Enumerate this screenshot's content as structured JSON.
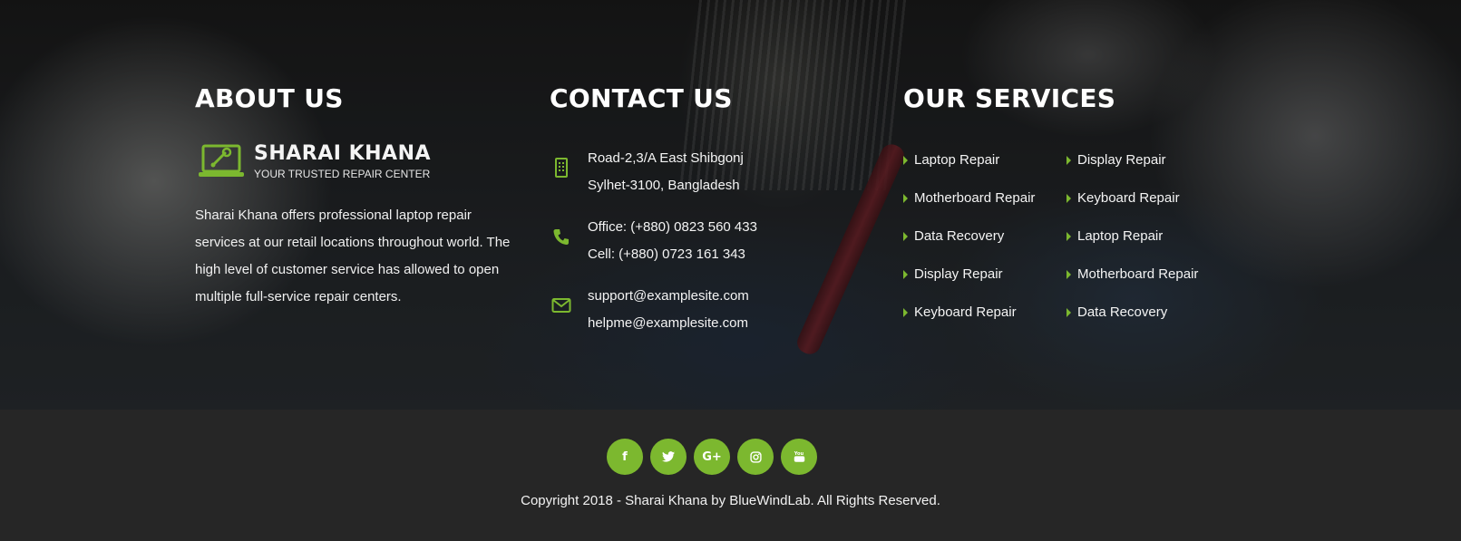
{
  "about": {
    "heading": "ABOUT US",
    "logo_brand": "SHARAI KHANA",
    "logo_tagline": "YOUR TRUSTED REPAIR CENTER",
    "logo_icon": "laptop-wrench-icon",
    "text": "Sharai Khana offers professional laptop repair services at our retail locations throughout world. The high level of customer service has allowed to open multiple full-service repair centers."
  },
  "contact": {
    "heading": "CONTACT US",
    "items": [
      {
        "icon": "building-icon",
        "lines": [
          "Road-2,3/A East Shibgonj",
          "Sylhet-3100, Bangladesh"
        ]
      },
      {
        "icon": "phone-icon",
        "lines": [
          "Office: (+880) 0823 560 433",
          "Cell: (+880) 0723 161 343"
        ]
      },
      {
        "icon": "envelope-icon",
        "lines": [
          "support@examplesite.com",
          "helpme@examplesite.com"
        ]
      }
    ]
  },
  "services": {
    "heading": "OUR SERVICES",
    "items": [
      "Laptop Repair",
      "Display Repair",
      "Motherboard Repair",
      "Keyboard Repair",
      "Data Recovery",
      "Laptop Repair",
      "Display Repair",
      "Motherboard Repair",
      "Keyboard Repair",
      "Data Recovery"
    ]
  },
  "footer": {
    "socials": [
      {
        "icon": "facebook-icon",
        "glyph": "f"
      },
      {
        "icon": "twitter-icon",
        "glyph": "t"
      },
      {
        "icon": "google-plus-icon",
        "glyph": "G+"
      },
      {
        "icon": "instagram-icon",
        "glyph": "◎"
      },
      {
        "icon": "youtube-icon",
        "glyph": "You"
      }
    ],
    "copyright": "Copyright 2018 - Sharai Khana by BlueWindLab. All Rights Reserved."
  },
  "colors": {
    "accent": "#7cb82f",
    "footer_bg": "#262626",
    "text": "#ffffff"
  }
}
